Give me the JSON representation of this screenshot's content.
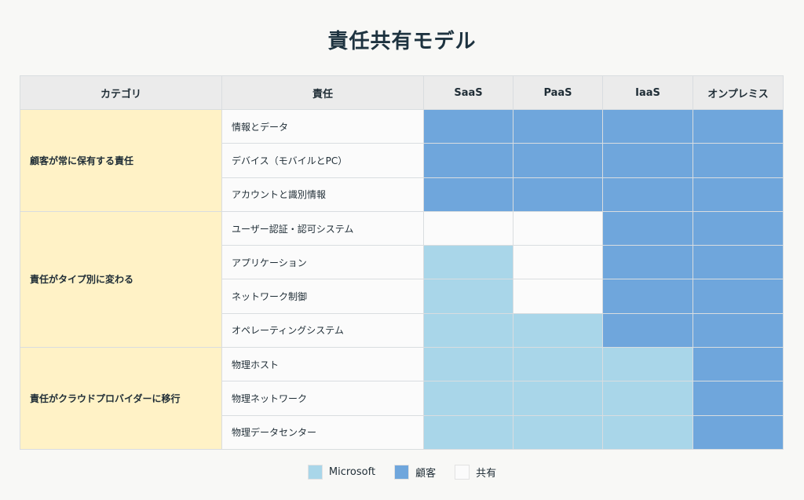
{
  "title": "責任共有モデル",
  "columns": [
    "カテゴリ",
    "責任",
    "SaaS",
    "PaaS",
    "IaaS",
    "オンプレミス"
  ],
  "colors": {
    "Microsoft": "#a9d6e9",
    "顧客": "#6fa6dc",
    "共有": "#fbfbfb",
    "category_bg": "#fff2c6"
  },
  "groups": [
    {
      "category": "顧客が常に保有する責任",
      "rows": [
        {
          "responsibility": "情報とデータ",
          "cells": [
            "顧客",
            "顧客",
            "顧客",
            "顧客"
          ]
        },
        {
          "responsibility": "デバイス（モバイルとPC）",
          "cells": [
            "顧客",
            "顧客",
            "顧客",
            "顧客"
          ]
        },
        {
          "responsibility": "アカウントと識別情報",
          "cells": [
            "顧客",
            "顧客",
            "顧客",
            "顧客"
          ]
        }
      ]
    },
    {
      "category": "責任がタイプ別に変わる",
      "rows": [
        {
          "responsibility": "ユーザー認証・認可システム",
          "cells": [
            "共有",
            "共有",
            "顧客",
            "顧客"
          ]
        },
        {
          "responsibility": "アプリケーション",
          "cells": [
            "Microsoft",
            "共有",
            "顧客",
            "顧客"
          ]
        },
        {
          "responsibility": "ネットワーク制御",
          "cells": [
            "Microsoft",
            "共有",
            "顧客",
            "顧客"
          ]
        },
        {
          "responsibility": "オペレーティングシステム",
          "cells": [
            "Microsoft",
            "Microsoft",
            "顧客",
            "顧客"
          ]
        }
      ]
    },
    {
      "category": "責任がクラウドプロバイダーに移行",
      "rows": [
        {
          "responsibility": "物理ホスト",
          "cells": [
            "Microsoft",
            "Microsoft",
            "Microsoft",
            "顧客"
          ]
        },
        {
          "responsibility": "物理ネットワーク",
          "cells": [
            "Microsoft",
            "Microsoft",
            "Microsoft",
            "顧客"
          ]
        },
        {
          "responsibility": "物理データセンター",
          "cells": [
            "Microsoft",
            "Microsoft",
            "Microsoft",
            "顧客"
          ]
        }
      ]
    }
  ],
  "legend": [
    {
      "label": "Microsoft",
      "color": "#a9d6e9"
    },
    {
      "label": "顧客",
      "color": "#6fa6dc"
    },
    {
      "label": "共有",
      "color": "#fbfbfb"
    }
  ]
}
